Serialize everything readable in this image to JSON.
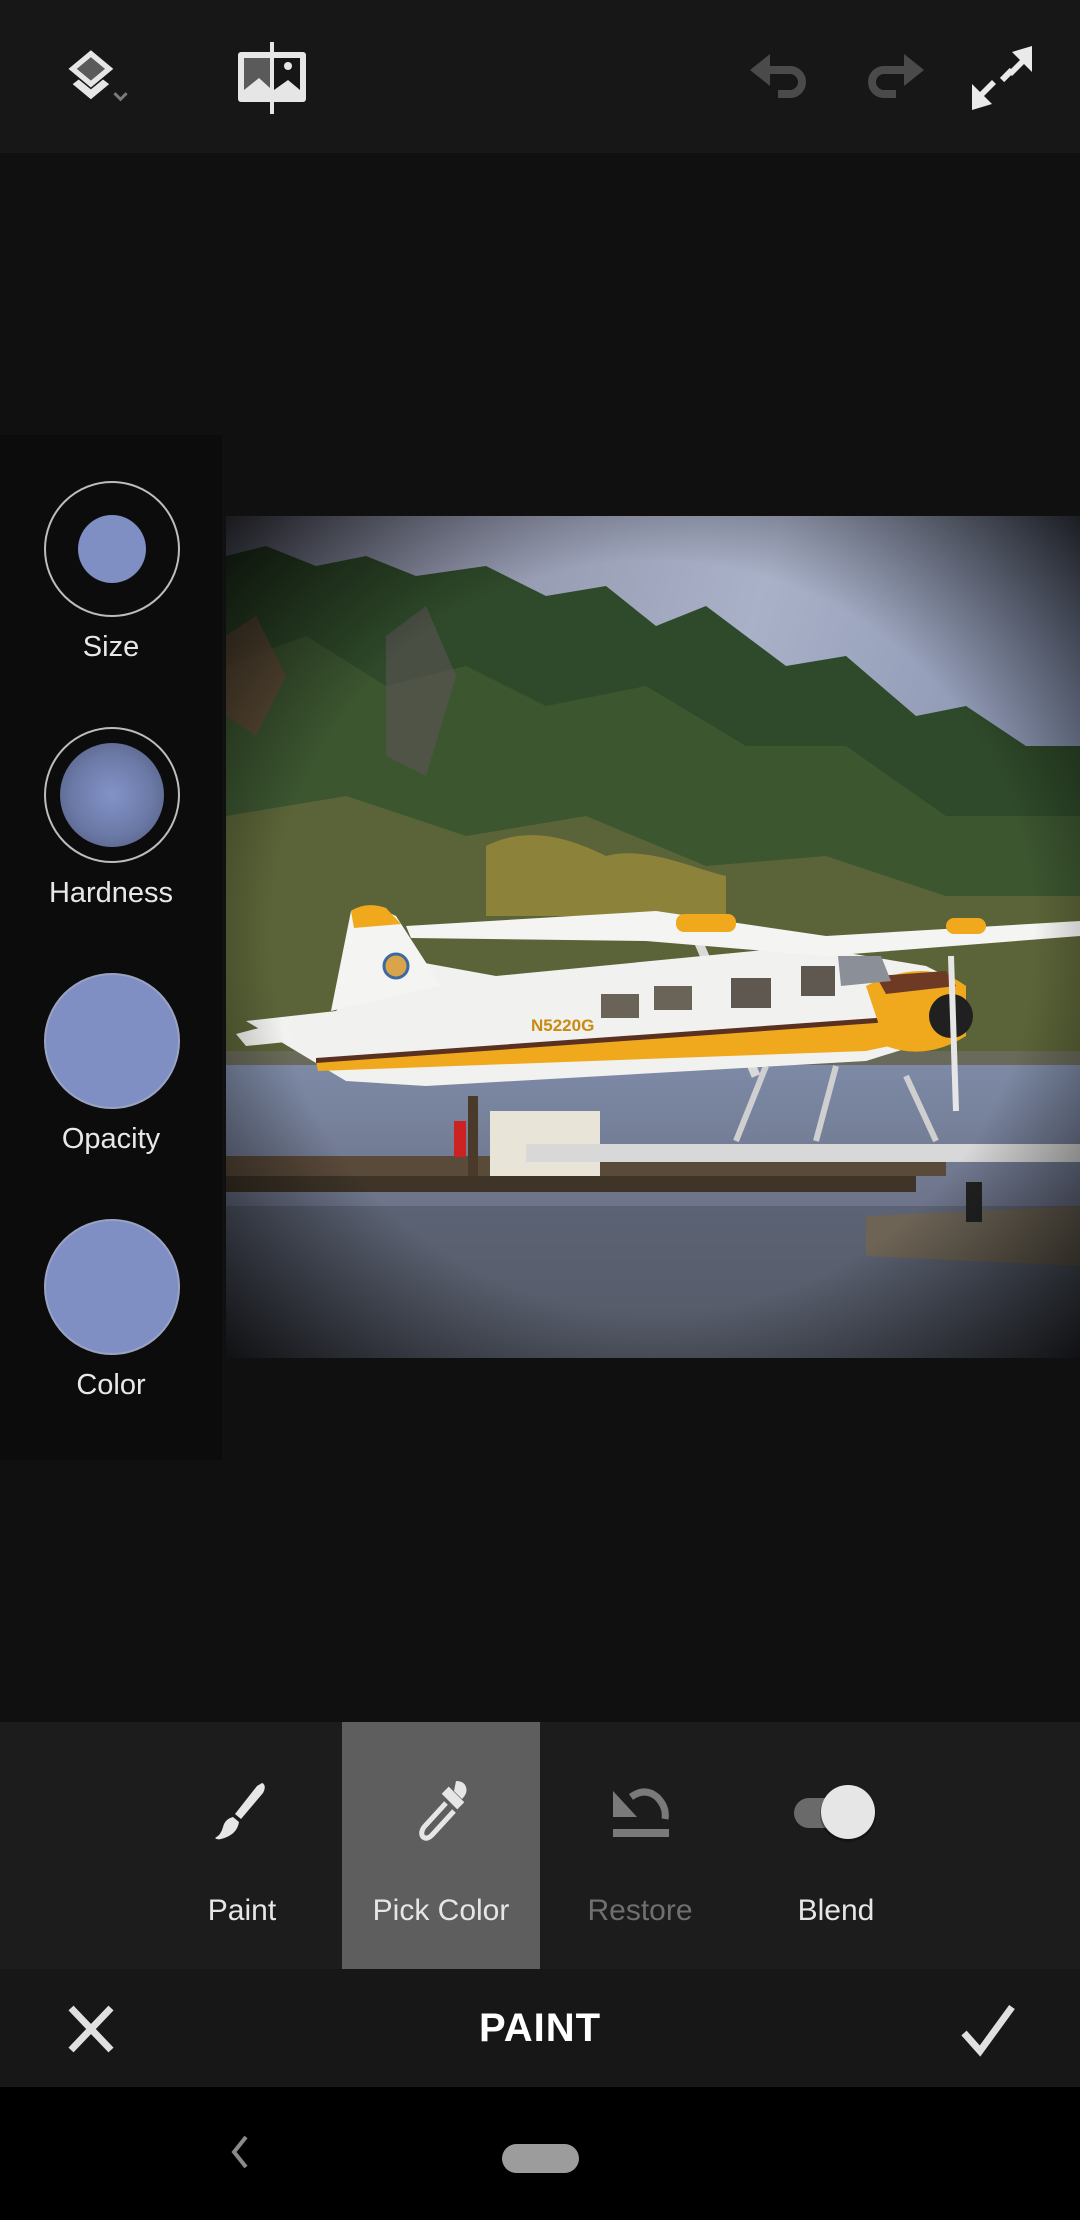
{
  "app": {
    "mode_title": "PAINT"
  },
  "topbar": {
    "icons": [
      {
        "name": "layers-icon",
        "state": "enabled",
        "has_dropdown": true
      },
      {
        "name": "compare-before-after-icon",
        "state": "enabled"
      },
      {
        "name": "undo-icon",
        "state": "disabled"
      },
      {
        "name": "redo-icon",
        "state": "disabled"
      },
      {
        "name": "fullscreen-expand-icon",
        "state": "enabled"
      }
    ]
  },
  "brush_panel": {
    "controls": [
      {
        "id": "size",
        "label": "Size"
      },
      {
        "id": "hardness",
        "label": "Hardness"
      },
      {
        "id": "opacity",
        "label": "Opacity"
      },
      {
        "id": "color",
        "label": "Color"
      }
    ],
    "brush_color": "#7f8fc4"
  },
  "photo": {
    "description": "Yellow and white floatplane docked at a wooden pier on water with a tree-covered hillside behind",
    "registration_marking": "N5220G"
  },
  "tools": [
    {
      "id": "paint",
      "label": "Paint",
      "icon": "paintbrush-icon",
      "active": false,
      "disabled": false
    },
    {
      "id": "pick_color",
      "label": "Pick Color",
      "icon": "eyedropper-icon",
      "active": true,
      "disabled": false
    },
    {
      "id": "restore",
      "label": "Restore",
      "icon": "restore-icon",
      "active": false,
      "disabled": true
    },
    {
      "id": "blend",
      "label": "Blend",
      "icon": "toggle-icon",
      "active": false,
      "disabled": false,
      "toggle_on": true
    }
  ],
  "footer": {
    "cancel_icon": "close-icon",
    "confirm_icon": "checkmark-icon"
  },
  "colors": {
    "accent_brush": "#7f8fc4",
    "active_tool_bg": "#5e5e5e",
    "toolbar_bg": "#1c1c1c",
    "topbar_bg": "#171717"
  }
}
